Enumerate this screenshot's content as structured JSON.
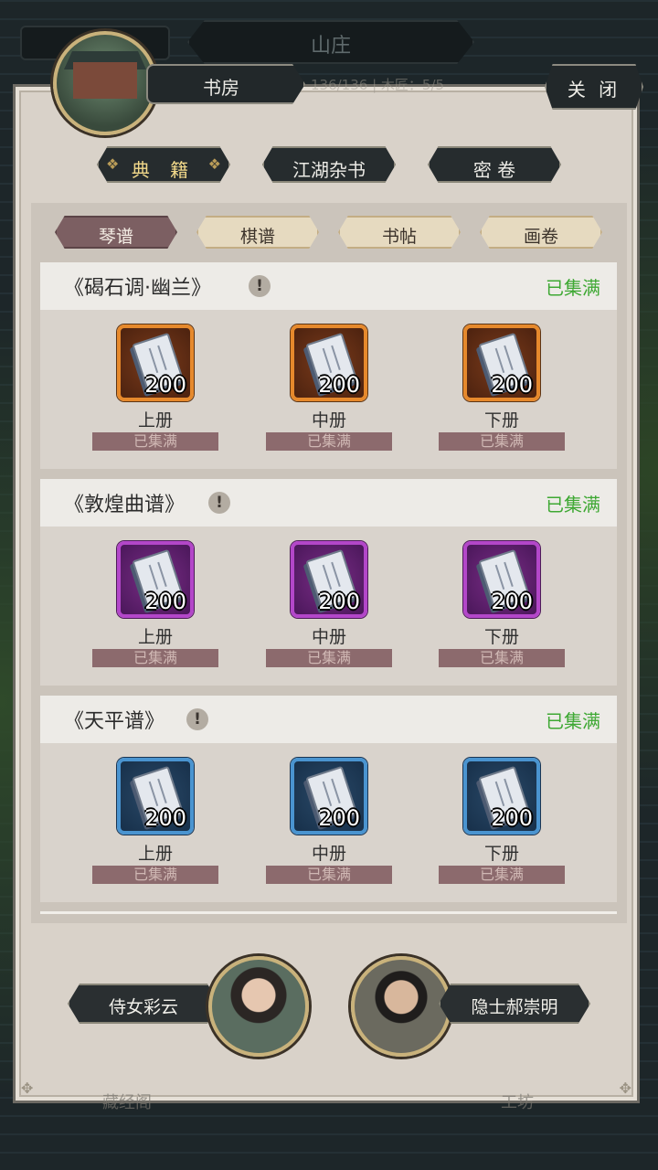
{
  "header": {
    "top_title": "山庄",
    "ghost_stats": "136/136 | 木匠：5/5",
    "room_title": "书房",
    "close_label": "关 闭"
  },
  "categories": [
    {
      "label": "典 籍",
      "active": true
    },
    {
      "label": "江湖杂书",
      "active": false
    },
    {
      "label": "密 卷",
      "active": false
    }
  ],
  "subtabs": [
    {
      "label": "琴谱",
      "active": true
    },
    {
      "label": "棋谱",
      "active": false
    },
    {
      "label": "书帖",
      "active": false
    },
    {
      "label": "画卷",
      "active": false
    }
  ],
  "collections": [
    {
      "title": "《碣石调·幽兰》",
      "info_icon": "!",
      "status": "已集满",
      "quality": "orange",
      "items": [
        {
          "count": "200",
          "label": "上册",
          "status": "已集满"
        },
        {
          "count": "200",
          "label": "中册",
          "status": "已集满"
        },
        {
          "count": "200",
          "label": "下册",
          "status": "已集满"
        }
      ]
    },
    {
      "title": "《敦煌曲谱》",
      "info_icon": "!",
      "status": "已集满",
      "quality": "purple",
      "items": [
        {
          "count": "200",
          "label": "上册",
          "status": "已集满"
        },
        {
          "count": "200",
          "label": "中册",
          "status": "已集满"
        },
        {
          "count": "200",
          "label": "下册",
          "status": "已集满"
        }
      ]
    },
    {
      "title": "《天平谱》",
      "info_icon": "!",
      "status": "已集满",
      "quality": "blue",
      "items": [
        {
          "count": "200",
          "label": "上册",
          "status": "已集满"
        },
        {
          "count": "200",
          "label": "中册",
          "status": "已集满"
        },
        {
          "count": "200",
          "label": "下册",
          "status": "已集满"
        }
      ]
    }
  ],
  "npcs": [
    {
      "name": "侍女彩云"
    },
    {
      "name": "隐士郝崇明"
    }
  ],
  "bottom_ghost": {
    "left": "藏经阁",
    "right": "工坊"
  },
  "colors": {
    "accent_green": "#3ea833",
    "orange": "#e6892c",
    "purple": "#b347c9",
    "blue": "#4a94d0"
  }
}
